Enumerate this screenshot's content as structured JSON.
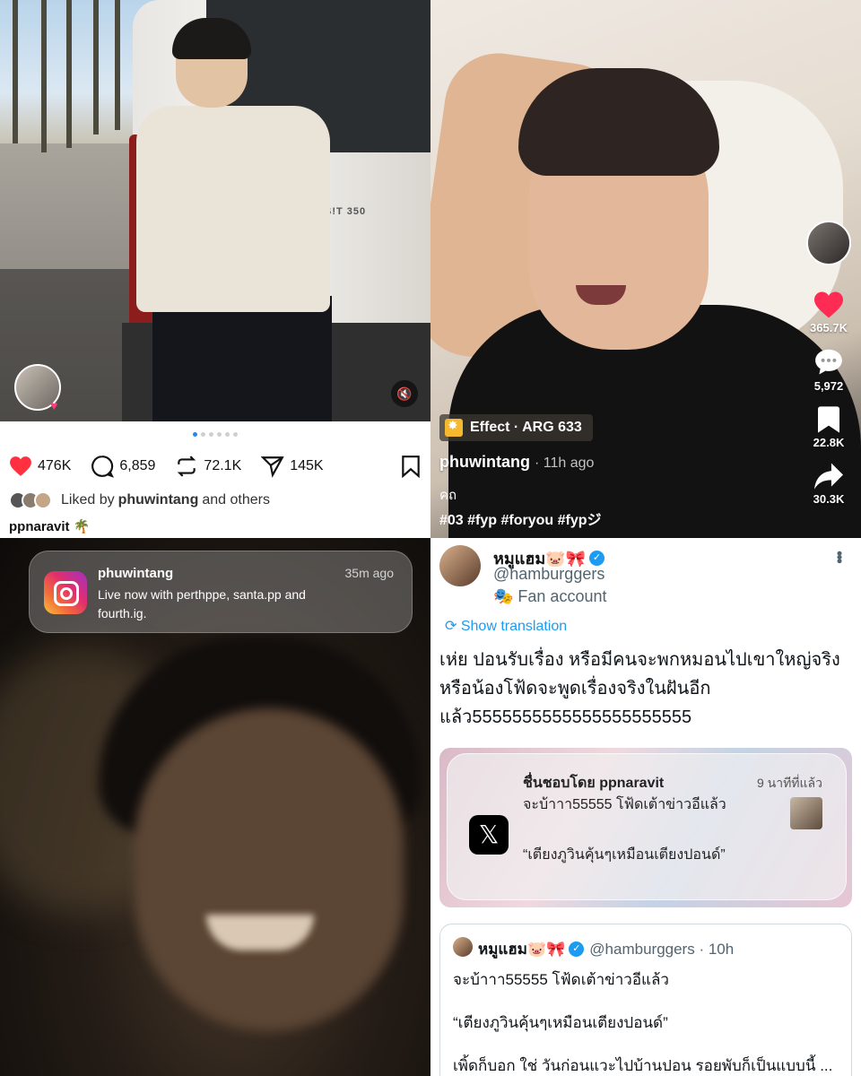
{
  "instagram_post": {
    "van_badge": "S!T 350",
    "carousel_pages": 6,
    "carousel_active_index": 0,
    "likes": "476K",
    "comments": "6,859",
    "reposts": "72.1K",
    "shares": "145K",
    "liked_by_prefix": "Liked by",
    "liked_by_user": "phuwintang",
    "liked_by_suffix": "and others",
    "owner": "ppnaravit 🌴",
    "heart_color": "#ff3040"
  },
  "tiktok": {
    "effect_label": "Effect · ARG 633",
    "username": "phuwintang",
    "time": "· 11h ago",
    "caption": "คถ",
    "hashtags": "#03 #fyp #foryou #fypジ",
    "likes": "365.7K",
    "comments": "5,972",
    "saves": "22.8K",
    "shares": "30.3K",
    "heart_color": "#fe2c55"
  },
  "live_notification": {
    "app": "instagram",
    "title": "phuwintang",
    "time": "35m ago",
    "body": "Live now with perthppe, santa.pp and fourth.ig."
  },
  "tweet": {
    "display_name": "หมูแฮม🐷🎀",
    "handle": "@hamburggers",
    "badge": "🎭 Fan account",
    "show_translation": "Show translation",
    "text": "เห่ย ปอนรับเรื่อง หรือมีคนจะพกหมอนไปเขาใหญ่จริง หรือน้องโฟ้ดจะพูดเรื่องจริงในฝันอีกแล้ว5555555555555555555555",
    "verified_color": "#1d9bf0",
    "notification_card": {
      "title": "ชื่นชอบโดย ppnaravit",
      "time": "9 นาทีที่แล้ว",
      "line1": "จะบ้าาา55555 โฟ้ดเต้าข่าวอีแล้ว",
      "line2": "“เตียงภูวินคุ้นๆเหมือนเตียงปอนด์”"
    },
    "quoted": {
      "display_name": "หมูแฮม🐷🎀",
      "meta": "@hamburggers · 10h",
      "line1": "จะบ้าาา55555 โฟ้ดเต้าข่าวอีแล้ว",
      "line2": "“เตียงภูวินคุ้นๆเหมือนเตียงปอนด์”",
      "line3": "เพิ้ดก็บอก ใช่ วันก่อนแวะไปบ้านปอน รอยพับก็เป็นแบบนี้ ..."
    }
  }
}
